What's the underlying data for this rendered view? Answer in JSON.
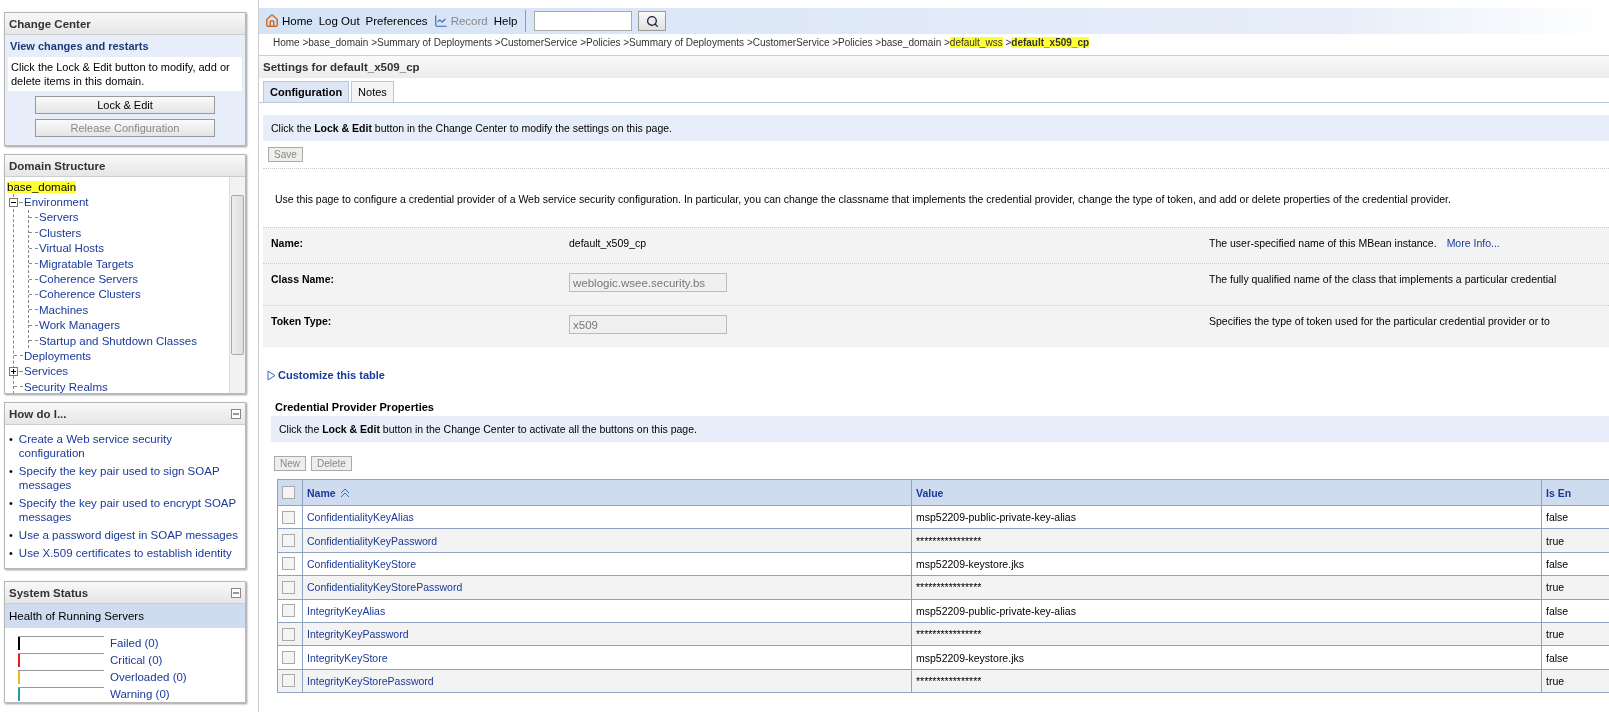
{
  "change_center": {
    "title": "Change Center",
    "subtitle": "View changes and restarts",
    "message": "Click the Lock & Edit button to modify, add or delete items in this domain.",
    "buttons": [
      {
        "label": "Lock & Edit",
        "disabled": false
      },
      {
        "label": "Release Configuration",
        "disabled": true
      }
    ]
  },
  "domain_structure": {
    "title": "Domain Structure",
    "tree": [
      {
        "label": "base_domain",
        "highlighted": true,
        "children": [
          {
            "label": "Environment",
            "expanded": true,
            "children": [
              {
                "label": "Servers"
              },
              {
                "label": "Clusters"
              },
              {
                "label": "Virtual Hosts"
              },
              {
                "label": "Migratable Targets"
              },
              {
                "label": "Coherence Servers"
              },
              {
                "label": "Coherence Clusters"
              },
              {
                "label": "Machines"
              },
              {
                "label": "Work Managers"
              },
              {
                "label": "Startup and Shutdown Classes"
              }
            ]
          },
          {
            "label": "Deployments"
          },
          {
            "label": "Services",
            "expanded": false
          },
          {
            "label": "Security Realms"
          }
        ]
      }
    ]
  },
  "how_do_i": {
    "title": "How do I...",
    "bullet": "•",
    "links": [
      "Create a Web service security configuration",
      "Specify the key pair used to sign SOAP messages",
      "Specify the key pair used to encrypt SOAP messages",
      "Use a password digest in SOAP messages",
      "Use X.509 certificates to establish identity"
    ]
  },
  "system_status": {
    "title": "System Status",
    "subtitle": "Health of Running Servers",
    "items": [
      {
        "label": "Failed (0)",
        "color": "#000000"
      },
      {
        "label": "Critical (0)",
        "color": "#e02020"
      },
      {
        "label": "Overloaded (0)",
        "color": "#f0b820"
      },
      {
        "label": "Warning (0)",
        "color": "#2a9aa8"
      }
    ]
  },
  "toolbar": {
    "items": [
      {
        "label": "Home",
        "kind": "home",
        "disabled": false
      },
      {
        "label": "Log Out",
        "kind": "link",
        "disabled": false
      },
      {
        "label": "Preferences",
        "kind": "link",
        "disabled": false
      },
      {
        "label": "Record",
        "kind": "record",
        "disabled": true
      },
      {
        "label": "Help",
        "kind": "link",
        "disabled": false
      }
    ]
  },
  "breadcrumb": {
    "separator": ">",
    "items": [
      {
        "label": "Home",
        "highlighted": false
      },
      {
        "label": "base_domain",
        "highlighted": false
      },
      {
        "label": "Summary of Deployments",
        "highlighted": false
      },
      {
        "label": "CustomerService",
        "highlighted": false
      },
      {
        "label": "Policies",
        "highlighted": false
      },
      {
        "label": "Summary of Deployments",
        "highlighted": false
      },
      {
        "label": "CustomerService",
        "highlighted": false
      },
      {
        "label": "Policies",
        "highlighted": false
      },
      {
        "label": "base_domain",
        "highlighted": false
      },
      {
        "label": "default_wss",
        "highlighted": true
      },
      {
        "label": "default_x509_cp",
        "highlighted": true,
        "current": true
      }
    ]
  },
  "settings": {
    "title": "Settings for default_x509_cp",
    "tabs": [
      {
        "label": "Configuration",
        "selected": true
      },
      {
        "label": "Notes",
        "selected": false
      }
    ],
    "notice": "Click the **Lock & Edit** button in the Change Center to modify the settings on this page.",
    "save_button": {
      "label": "Save",
      "disabled": true
    },
    "description": "Use this page to configure a credential provider of a Web service security configuration. In particular, you can change the classname that implements the credential provider, change the type of token, and add or delete properties of the credential provider.",
    "fields": [
      {
        "label": "Name:",
        "kind": "text",
        "value": "default_x509_cp",
        "help": "The user-specified name of this MBean instance.",
        "link": "More Info..."
      },
      {
        "label": "Class Name:",
        "kind": "input",
        "value": "weblogic.wsee.security.bs",
        "help": "The fully qualified name of the class that implements a particular credential"
      },
      {
        "label": "Token Type:",
        "kind": "input",
        "value": "x509",
        "help": "Specifies the type of token used for the particular credential provider or to"
      }
    ]
  },
  "customize": "Customize this table",
  "properties_table": {
    "title": "Credential Provider Properties",
    "notice": "Click the **Lock & Edit** button in the Change Center to activate all the buttons on this page.",
    "buttons": [
      {
        "label": "New",
        "disabled": true
      },
      {
        "label": "Delete",
        "disabled": true
      }
    ],
    "select_all_checked": false,
    "columns": [
      "Name",
      "Value",
      "Is En"
    ],
    "rows": [
      {
        "name": "ConfidentialityKeyAlias",
        "value": "msp52209-public-private-key-alias",
        "is_en": "false",
        "checked": false
      },
      {
        "name": "ConfidentialityKeyPassword",
        "value": "****************",
        "is_en": "true",
        "checked": false
      },
      {
        "name": "ConfidentialityKeyStore",
        "value": "msp52209-keystore.jks",
        "is_en": "false",
        "checked": false
      },
      {
        "name": "ConfidentialityKeyStorePassword",
        "value": "****************",
        "is_en": "true",
        "checked": false
      },
      {
        "name": "IntegrityKeyAlias",
        "value": "msp52209-public-private-key-alias",
        "is_en": "false",
        "checked": false
      },
      {
        "name": "IntegrityKeyPassword",
        "value": "****************",
        "is_en": "true",
        "checked": false
      },
      {
        "name": "IntegrityKeyStore",
        "value": "msp52209-keystore.jks",
        "is_en": "false",
        "checked": false
      },
      {
        "name": "IntegrityKeyStorePassword",
        "value": "****************",
        "is_en": "true",
        "checked": false
      }
    ]
  }
}
